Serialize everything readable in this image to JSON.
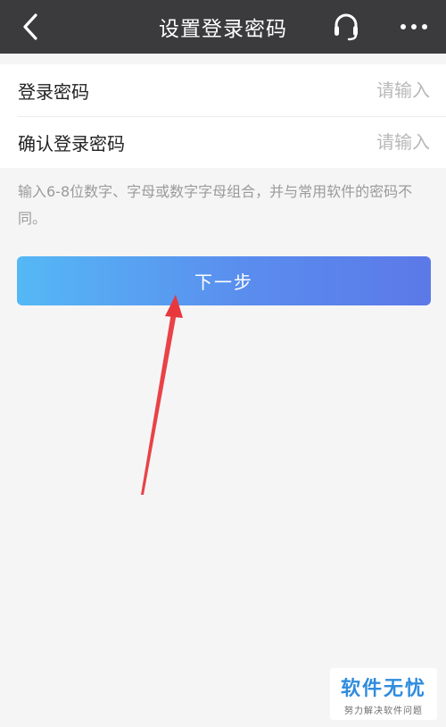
{
  "header": {
    "title": "设置登录密码",
    "back_icon": "chevron-left-icon",
    "support_icon": "headset-icon",
    "more_icon": "more-dots-icon",
    "background_color": "#3b3b3e"
  },
  "form": {
    "fields": [
      {
        "label": "登录密码",
        "placeholder": "请输入",
        "value": ""
      },
      {
        "label": "确认登录密码",
        "placeholder": "请输入",
        "value": ""
      }
    ]
  },
  "hint": "输入6-8位数字、字母或数字字母组合，并与常用软件的密码不同。",
  "next_button": {
    "label": "下一步",
    "gradient_start": "#55b8f5",
    "gradient_end": "#5b79e8"
  },
  "annotation": {
    "arrow_color": "#e8383d"
  },
  "watermark": {
    "main": "软件无忧",
    "sub": "努力解决软件问题"
  }
}
